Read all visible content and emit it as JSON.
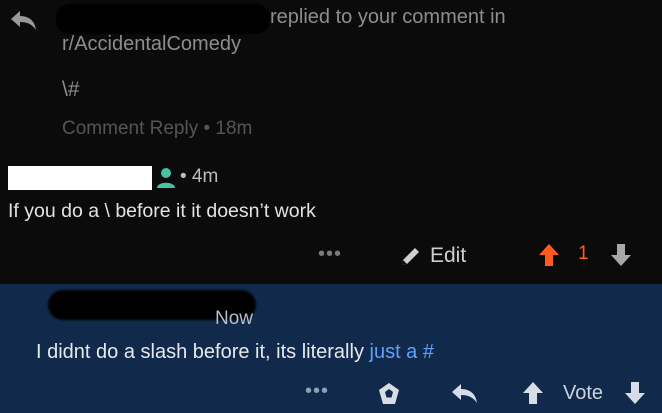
{
  "notification": {
    "action_text": "replied to your comment in",
    "subreddit": "r/AccidentalComedy",
    "body": "\\#",
    "meta": "Comment Reply • 18m"
  },
  "comment": {
    "meta": "• 4m",
    "text": "If you do a \\ before it it doesn’t work",
    "more_label": "•••",
    "edit_label": "Edit",
    "vote_count": "1"
  },
  "reply": {
    "time": "Now",
    "text": "I didnt do a slash before it, its literally ",
    "link_text": "just a #",
    "more_label": "•••",
    "vote_label": "Vote"
  },
  "colors": {
    "background": "#0b0b0c",
    "reply_background": "#112a4b",
    "upvote": "#ff5a1f",
    "link": "#5fa0ff",
    "user_icon": "#46c3a3"
  },
  "icons": [
    "reply-arrow-icon",
    "user-icon",
    "more-icon",
    "pencil-icon",
    "upvote-icon",
    "downvote-icon",
    "award-icon"
  ]
}
